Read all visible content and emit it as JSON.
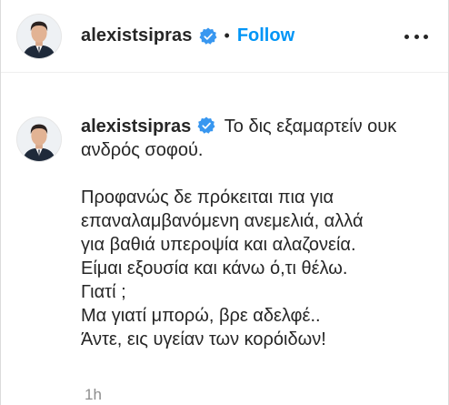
{
  "header": {
    "username": "alexistsipras",
    "separator": "•",
    "follow_label": "Follow",
    "more_icon": "more-horizontal-icon",
    "verified_icon": "verified-badge-icon"
  },
  "caption": {
    "username": "alexistsipras",
    "intro": "Το δις εξαμαρτείν ουκ ανδρός σοφού.",
    "lines": [
      "Προφανώς δε πρόκειται πια για",
      "επαναλαμβανόμενη ανεμελιά, αλλά",
      "για βαθιά υπεροψία και αλαζονεία.",
      "Είμαι εξουσία και κάνω ό,τι θέλω.",
      "Γιατί ;",
      "Μα γιατί μπορώ, βρε αδελφέ..",
      "Άντε, εις υγείαν των κορόιδων!"
    ],
    "timestamp": "1h"
  },
  "colors": {
    "link": "#0095f6",
    "verified": "#3897f0",
    "text": "#262626",
    "muted": "#8e8e8e"
  }
}
